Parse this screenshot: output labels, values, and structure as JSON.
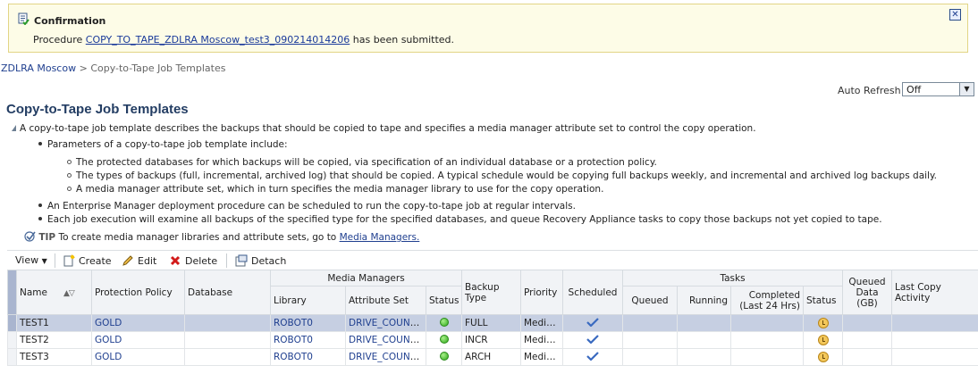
{
  "confirmation": {
    "title": "Confirmation",
    "prefix": "Procedure ",
    "link": "COPY_TO_TAPE_ZDLRA Moscow_test3_090214014206",
    "suffix": " has been submitted.",
    "close_icon": "close-icon"
  },
  "breadcrumb": {
    "root": "ZDLRA Moscow",
    "separator": " > ",
    "current": "Copy-to-Tape Job Templates"
  },
  "auto_refresh": {
    "label": "Auto Refresh",
    "value": "Off"
  },
  "page_title": "Copy-to-Tape Job Templates",
  "description": {
    "intro": "A copy-to-tape job template describes the backups that should be copied to tape and specifies a media manager attribute set to control the copy operation.",
    "bullets": [
      "Parameters of a copy-to-tape job template include:",
      "An Enterprise Manager deployment procedure can be scheduled to run the copy-to-tape job at regular intervals.",
      "Each job execution will examine all backups of the specified type for the specified databases, and queue Recovery Appliance tasks to copy those backups not yet copied to tape."
    ],
    "sub_bullets": [
      "The protected databases for which backups will be copied, via specification of an individual database or a protection policy.",
      "The types of backups (full, incremental, archived log) that should be copied. A typical schedule would be copying full backups weekly, and incremental and archived log backups daily.",
      "A media manager attribute set, which in turn specifies the media manager library to use for the copy operation."
    ]
  },
  "tip": {
    "label": "TIP",
    "text": "To create media manager libraries and attribute sets, go to ",
    "link": "Media Managers."
  },
  "toolbar": {
    "view": "View",
    "create": "Create",
    "edit": "Edit",
    "delete": "Delete",
    "detach": "Detach"
  },
  "table": {
    "group_headers": {
      "media_managers": "Media Managers",
      "tasks": "Tasks"
    },
    "headers": {
      "name": "Name",
      "protection_policy": "Protection Policy",
      "database": "Database",
      "library": "Library",
      "attribute_set": "Attribute Set",
      "mm_status": "Status",
      "backup_type_1": "Backup",
      "backup_type_2": "Type",
      "priority": "Priority",
      "scheduled": "Scheduled",
      "queued": "Queued",
      "running": "Running",
      "completed_1": "Completed",
      "completed_2": "(Last 24 Hrs)",
      "task_status": "Status",
      "queued_data_1": "Queued",
      "queued_data_2": "Data (GB)",
      "last_copy": "Last Copy Activity"
    },
    "rows": [
      {
        "name": "TEST1",
        "policy": "GOLD",
        "database": "",
        "library": "ROBOT0",
        "attribute_set": "DRIVE_COUNT...",
        "backup_type": "FULL",
        "priority": "Medium"
      },
      {
        "name": "TEST2",
        "policy": "GOLD",
        "database": "",
        "library": "ROBOT0",
        "attribute_set": "DRIVE_COUNT...",
        "backup_type": "INCR",
        "priority": "Medium"
      },
      {
        "name": "TEST3",
        "policy": "GOLD",
        "database": "",
        "library": "ROBOT0",
        "attribute_set": "DRIVE_COUNT...",
        "backup_type": "ARCH",
        "priority": "Medium"
      }
    ]
  }
}
